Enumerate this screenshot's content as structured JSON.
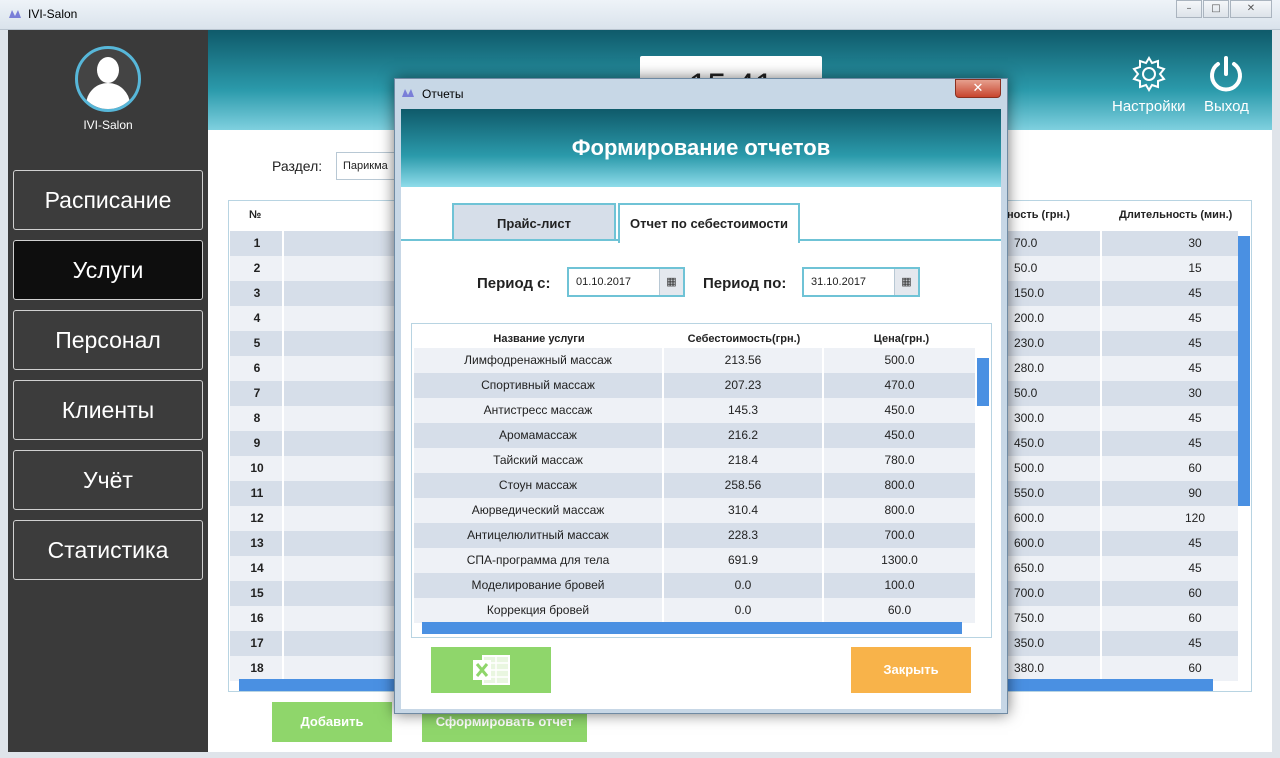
{
  "window": {
    "title": "IVI-Salon",
    "controls": {
      "minimize": "–",
      "maximize": "□",
      "close": "✕"
    }
  },
  "sidebar": {
    "user_name": "IVI-Salon",
    "items": [
      {
        "label": "Расписание",
        "active": false
      },
      {
        "label": "Услуги",
        "active": true
      },
      {
        "label": "Персонал",
        "active": false
      },
      {
        "label": "Клиенты",
        "active": false
      },
      {
        "label": "Учёт",
        "active": false
      },
      {
        "label": "Статистика",
        "active": false
      }
    ]
  },
  "header": {
    "clock": "15:41",
    "settings_label": "Настройки",
    "exit_label": "Выход"
  },
  "main": {
    "section_label": "Раздел:",
    "section_value": "Парикма",
    "table": {
      "col_num": "№",
      "col_price": "ность (грн.)",
      "col_duration": "Длительность (мин.)",
      "rows": [
        {
          "n": "1",
          "price": "70.0",
          "duration": "30"
        },
        {
          "n": "2",
          "price": "50.0",
          "duration": "15"
        },
        {
          "n": "3",
          "price": "150.0",
          "duration": "45"
        },
        {
          "n": "4",
          "price": "200.0",
          "duration": "45"
        },
        {
          "n": "5",
          "price": "230.0",
          "duration": "45"
        },
        {
          "n": "6",
          "price": "280.0",
          "duration": "45"
        },
        {
          "n": "7",
          "price": "50.0",
          "duration": "30"
        },
        {
          "n": "8",
          "price": "300.0",
          "duration": "45"
        },
        {
          "n": "9",
          "price": "450.0",
          "duration": "45"
        },
        {
          "n": "10",
          "price": "500.0",
          "duration": "60"
        },
        {
          "n": "11",
          "price": "550.0",
          "duration": "90"
        },
        {
          "n": "12",
          "price": "600.0",
          "duration": "120"
        },
        {
          "n": "13",
          "price": "600.0",
          "duration": "45"
        },
        {
          "n": "14",
          "price": "650.0",
          "duration": "45"
        },
        {
          "n": "15",
          "price": "700.0",
          "duration": "60"
        },
        {
          "n": "16",
          "price": "750.0",
          "duration": "60"
        },
        {
          "n": "17",
          "price": "350.0",
          "duration": "45"
        },
        {
          "n": "18",
          "price": "380.0",
          "duration": "60"
        }
      ]
    },
    "add_button": "Добавить",
    "report_button": "Сформировать отчет"
  },
  "dialog": {
    "title": "Отчеты",
    "close_glyph": "✕",
    "heading": "Формирование отчетов",
    "tabs": [
      {
        "label": "Прайс-лист",
        "active": false
      },
      {
        "label": "Отчет по себестоимости",
        "active": true
      }
    ],
    "period_from_label": "Период с:",
    "period_from_value": "01.10.2017",
    "period_to_label": "Период по:",
    "period_to_value": "31.10.2017",
    "calendar_glyph": "▦",
    "table": {
      "columns": [
        "Название услуги",
        "Себестоимость(грн.)",
        "Цена(грн.)"
      ],
      "rows": [
        [
          "Лимфодренажный массаж",
          "213.56",
          "500.0"
        ],
        [
          "Спортивный массаж",
          "207.23",
          "470.0"
        ],
        [
          "Антистресс массаж",
          "145.3",
          "450.0"
        ],
        [
          "Аромамассаж",
          "216.2",
          "450.0"
        ],
        [
          "Тайский массаж",
          "218.4",
          "780.0"
        ],
        [
          "Стоун массаж",
          "258.56",
          "800.0"
        ],
        [
          "Аюрведический массаж",
          "310.4",
          "800.0"
        ],
        [
          "Антицелюлитный массаж",
          "228.3",
          "700.0"
        ],
        [
          "СПА-программа для тела",
          "691.9",
          "1300.0"
        ],
        [
          "Моделирование бровей",
          "0.0",
          "100.0"
        ],
        [
          "Коррекция бровей",
          "0.0",
          "60.0"
        ]
      ]
    },
    "excel_icon": "excel-icon",
    "close_button": "Закрыть"
  },
  "colors": {
    "accent": "#2b9aab",
    "scrollbar": "#4a90e2",
    "green_button": "#8fd66b",
    "orange_button": "#f8b34a",
    "sidebar": "#3a3a3a"
  }
}
